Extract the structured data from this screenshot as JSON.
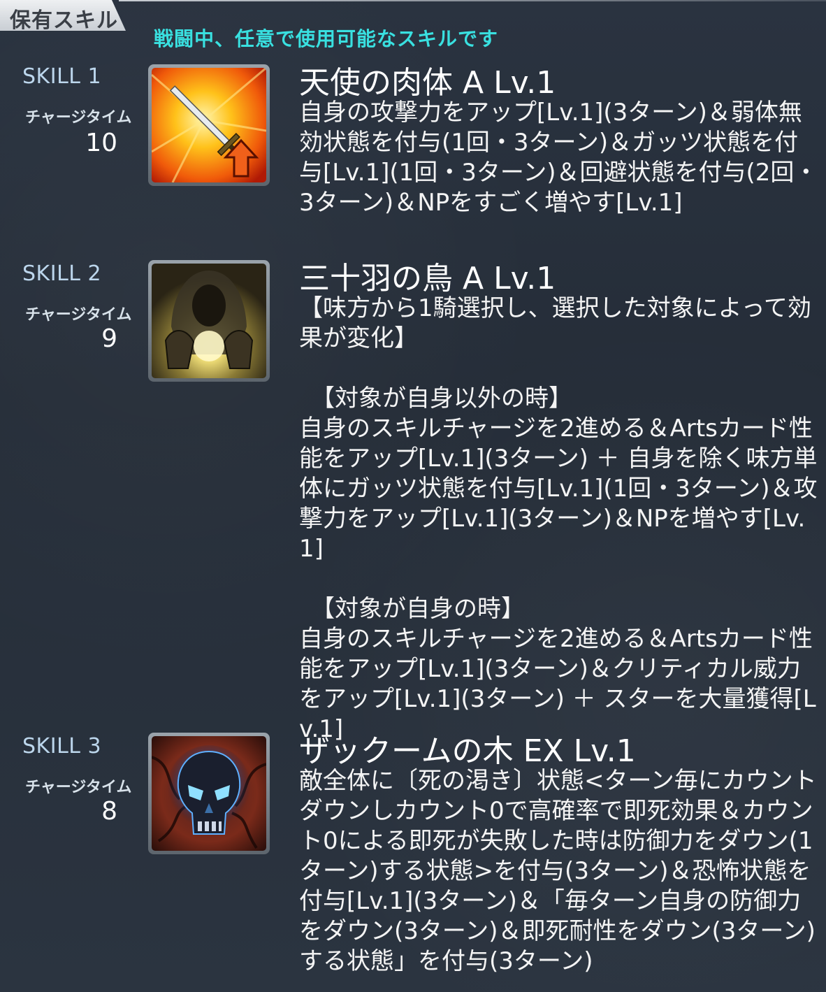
{
  "header": {
    "tab_label": "保有スキル",
    "subtitle": "戦闘中、任意で使用可能なスキルです"
  },
  "skills": [
    {
      "slot_label": "SKILL 1",
      "charge_label": "チャージタイム",
      "charge_value": "10",
      "icon": "sword-attack-up-icon",
      "name": "天使の肉体 A Lv.1",
      "description": "自身の攻撃力をアップ[Lv.1](3ターン)＆弱体無効状態を付与(1回・3ターン)＆ガッツ状態を付与[Lv.1](1回・3ターン)＆回避状態を付与(2回・3ターン)＆NPをすごく増やす[Lv.1]"
    },
    {
      "slot_label": "SKILL 2",
      "charge_label": "チャージタイム",
      "charge_value": "9",
      "icon": "hooded-figure-orb-icon",
      "name": "三十羽の鳥 A Lv.1",
      "description": "【味方から1騎選択し、選択した対象によって効果が変化】\n\n　【対象が自身以外の時】\n自身のスキルチャージを2進める＆Artsカード性能をアップ[Lv.1](3ターン) ＋ 自身を除く味方単体にガッツ状態を付与[Lv.1](1回・3ターン)＆攻撃力をアップ[Lv.1](3ターン)＆NPを増やす[Lv.1]\n\n　【対象が自身の時】\n自身のスキルチャージを2進める＆Artsカード性能をアップ[Lv.1](3ターン)＆クリティカル威力をアップ[Lv.1](3ターン) ＋ スターを大量獲得[Lv.1]"
    },
    {
      "slot_label": "SKILL 3",
      "charge_label": "チャージタイム",
      "charge_value": "8",
      "icon": "skull-death-icon",
      "name": "ザックームの木 EX Lv.1",
      "description": "敵全体に〔死の渇き〕状態<ターン毎にカウントダウンしカウント0で高確率で即死効果＆カウント0による即死が失敗した時は防御力をダウン(1ターン)する状態>を付与(3ターン)＆恐怖状態を付与[Lv.1](3ターン)＆「毎ターン自身の防御力をダウン(3ターン)＆即死耐性をダウン(3ターン)する状態」を付与(3ターン)"
    }
  ]
}
